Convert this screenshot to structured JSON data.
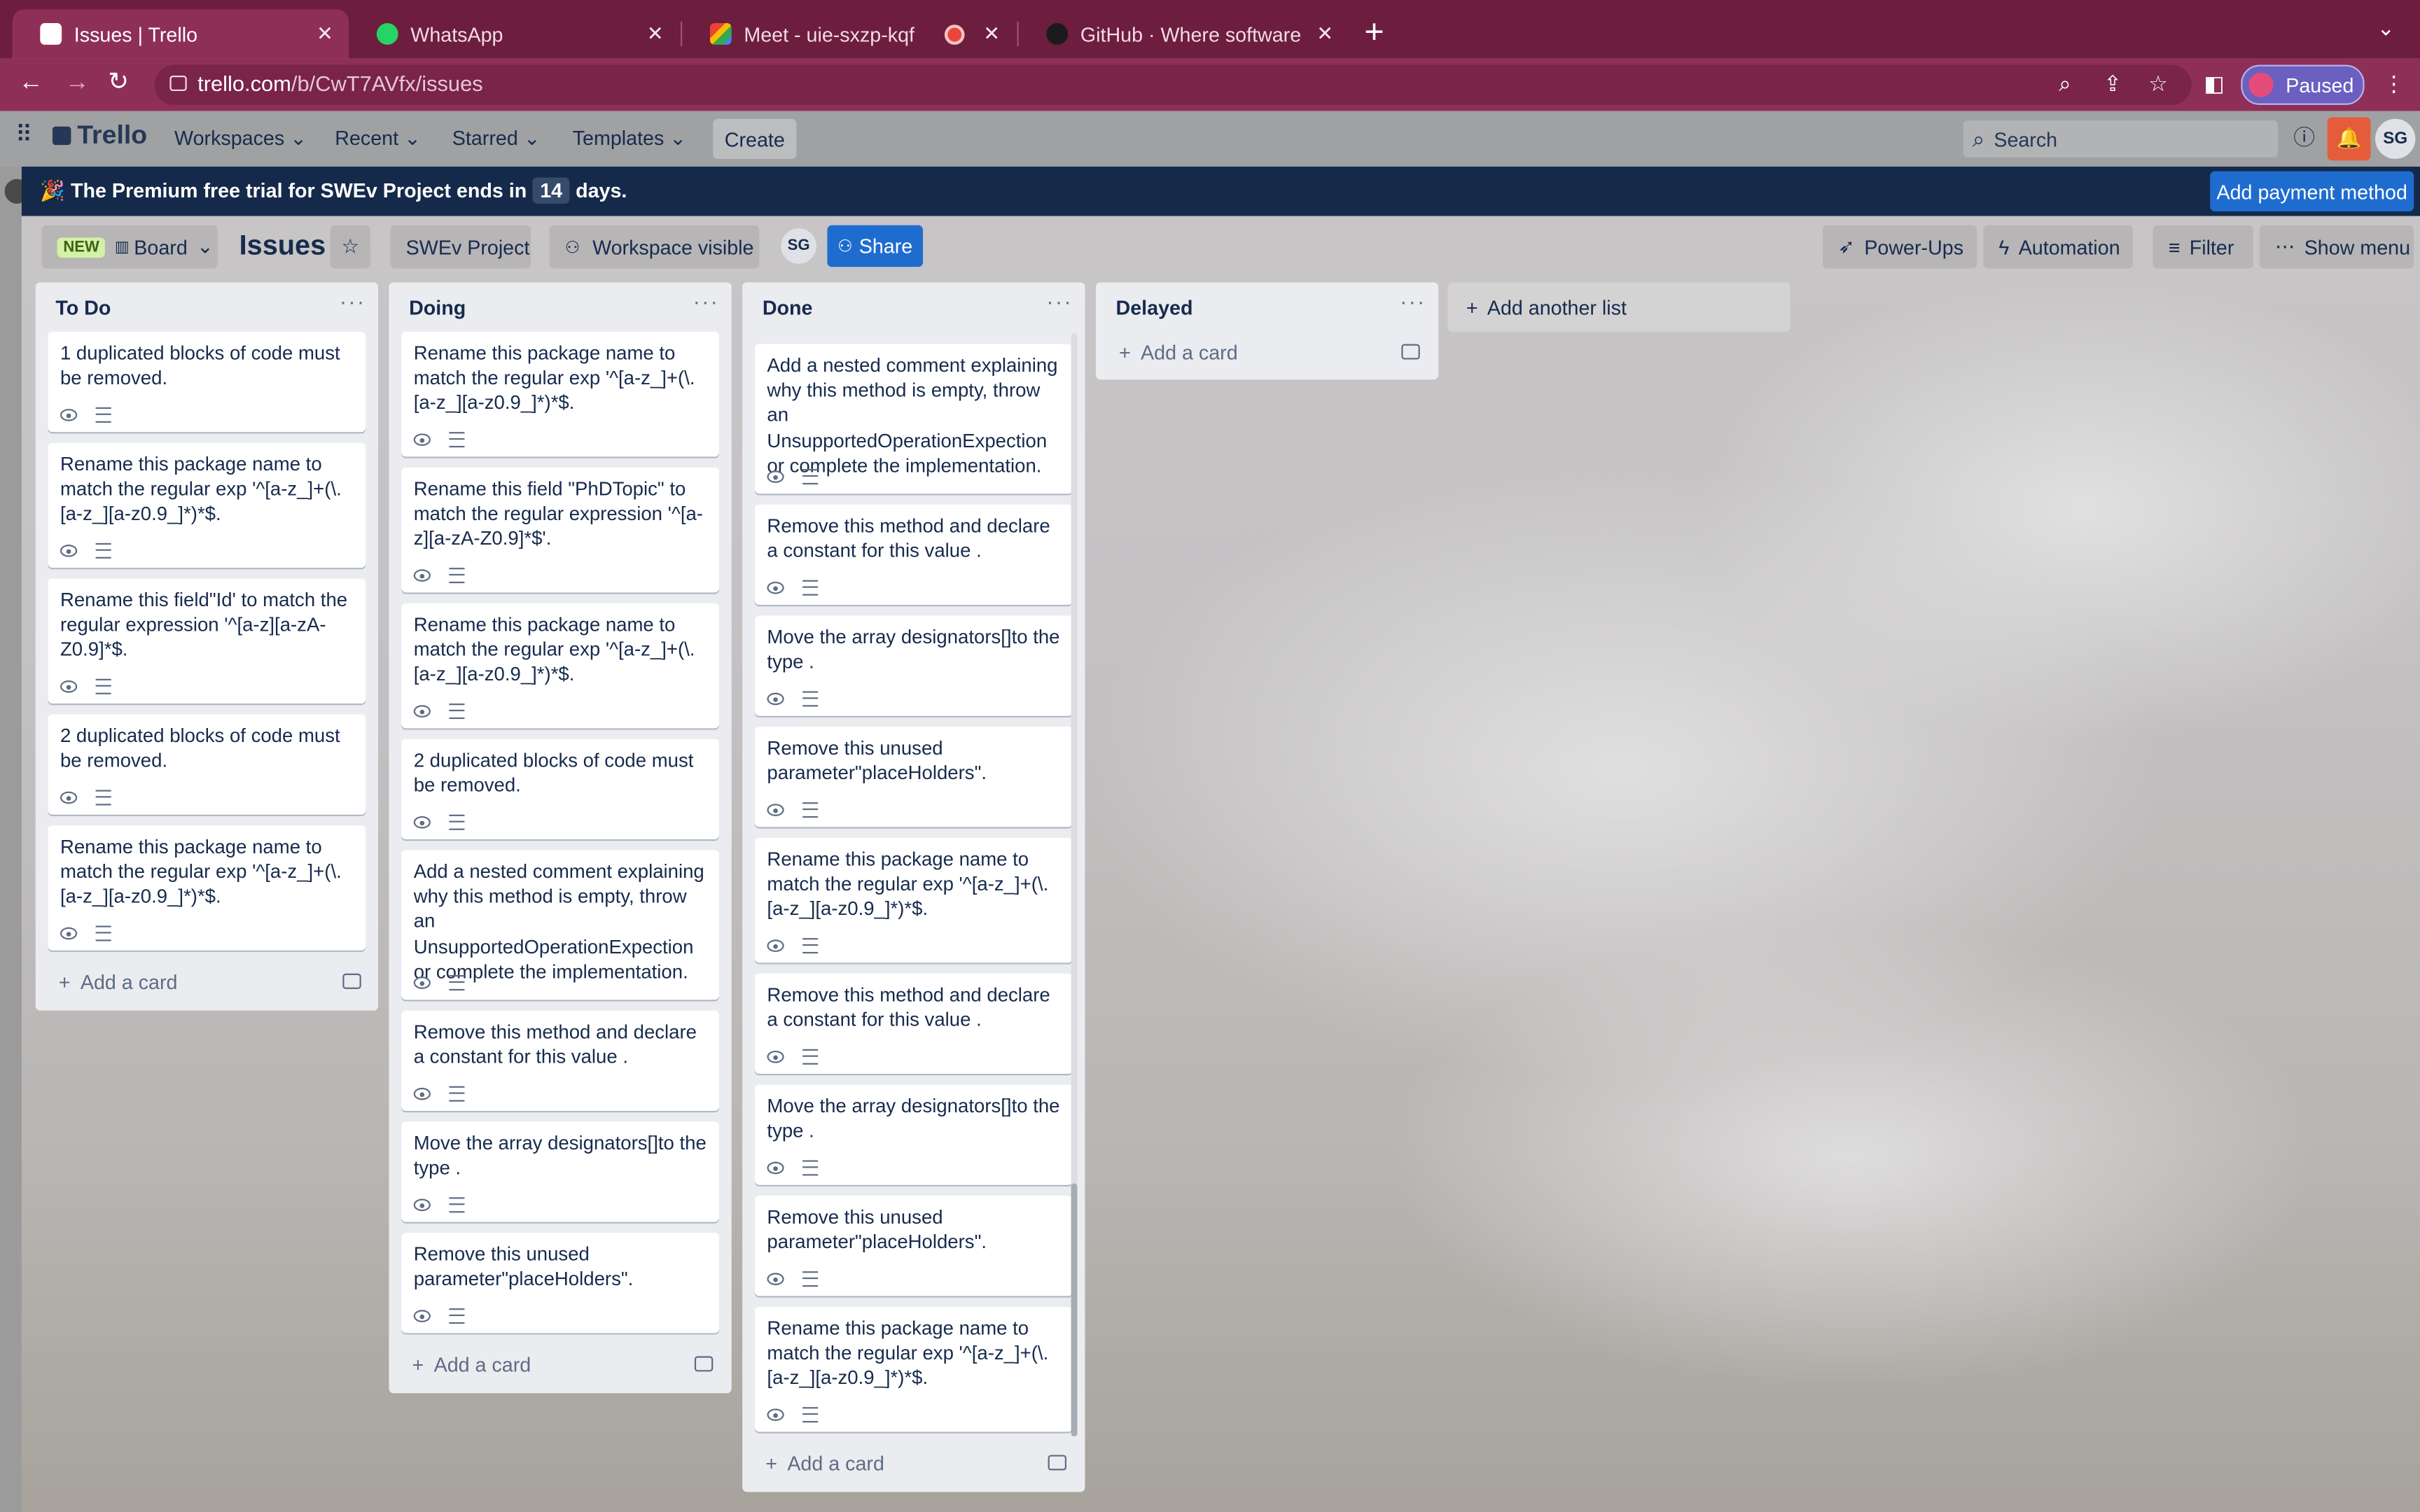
{
  "browser": {
    "tabs": [
      {
        "title": "Issues | Trello",
        "active": true,
        "favicon_color": "#ffffff"
      },
      {
        "title": "WhatsApp",
        "active": false,
        "favicon_color": "#25d366"
      },
      {
        "title": "Meet - uie-sxzp-kqf",
        "active": false,
        "favicon_color": "#00832d"
      },
      {
        "title": "GitHub · Where software is bui",
        "active": false,
        "favicon_color": "#111111"
      }
    ],
    "url_host": "trello.com",
    "url_path": "/b/CwT7AVfx/issues",
    "profile_status": "Paused"
  },
  "trello_header": {
    "logo": "Trello",
    "menus": [
      "Workspaces",
      "Recent",
      "Starred",
      "Templates"
    ],
    "create_label": "Create",
    "search_placeholder": "Search",
    "avatar_initials": "SG"
  },
  "banner": {
    "emoji": "🎉",
    "text_before": "The Premium free trial for SWEv Project ends in",
    "days": "14",
    "text_after": "days.",
    "button": "Add payment method"
  },
  "board": {
    "new_badge": "NEW",
    "view_label": "Board",
    "title": "Issues",
    "workspace": "SWEv Project",
    "visibility": "Workspace visible",
    "member_initials": "SG",
    "share_label": "Share",
    "power_ups": "Power-Ups",
    "automation": "Automation",
    "filter": "Filter",
    "show_menu": "Show menu"
  },
  "lists": [
    {
      "name": "To Do",
      "cards": [
        "1 duplicated blocks of code must be removed.",
        "Rename this package name to match the regular exp '^[a-z_]+(\\.[a-z_][a-z0.9_]*)*$.",
        "Rename this field\"Id' to match the regular expression '^[a-z][a-zA-Z0.9]*$.",
        "2 duplicated blocks of code must be removed.",
        "Rename this package name to match the regular exp '^[a-z_]+(\\.[a-z_][a-z0.9_]*)*$."
      ],
      "add_card": "Add a card"
    },
    {
      "name": "Doing",
      "cards": [
        "Rename this package name to match the regular exp '^[a-z_]+(\\.[a-z_][a-z0.9_]*)*$.",
        "Rename this field \"PhDTopic\" to match the regular expression '^[a-z][a-zA-Z0.9]*$'.",
        "Rename this package name to match the regular exp '^[a-z_]+(\\.[a-z_][a-z0.9_]*)*$.",
        "2 duplicated blocks of code must be removed.",
        "Add a nested comment explaining why this method is empty, throw an UnsupportedOperationExpection or complete the implementation.",
        "Remove this method and declare a constant for this value .",
        "Move the array designators[]to the type .",
        "Remove this unused parameter\"placeHolders\"."
      ],
      "add_card": "Add a card"
    },
    {
      "name": "Done",
      "cards": [
        "Add a nested comment explaining why this method is empty, throw an UnsupportedOperationExpection or complete the implementation.",
        "Remove this method and declare a constant for this value .",
        "Move the array designators[]to the type .",
        "Remove this unused parameter\"placeHolders\".",
        "Rename this package name to match the regular exp '^[a-z_]+(\\.[a-z_][a-z0.9_]*)*$.",
        "Remove this method and declare a constant for this value .",
        "Move the array designators[]to the type .",
        "Remove this unused parameter\"placeHolders\".",
        "Rename this package name to match the regular exp '^[a-z_]+(\\.[a-z_][a-z0.9_]*)*$."
      ],
      "add_card": "Add a card"
    },
    {
      "name": "Delayed",
      "cards": [],
      "add_card": "Add a card"
    }
  ],
  "add_list": "Add another list"
}
